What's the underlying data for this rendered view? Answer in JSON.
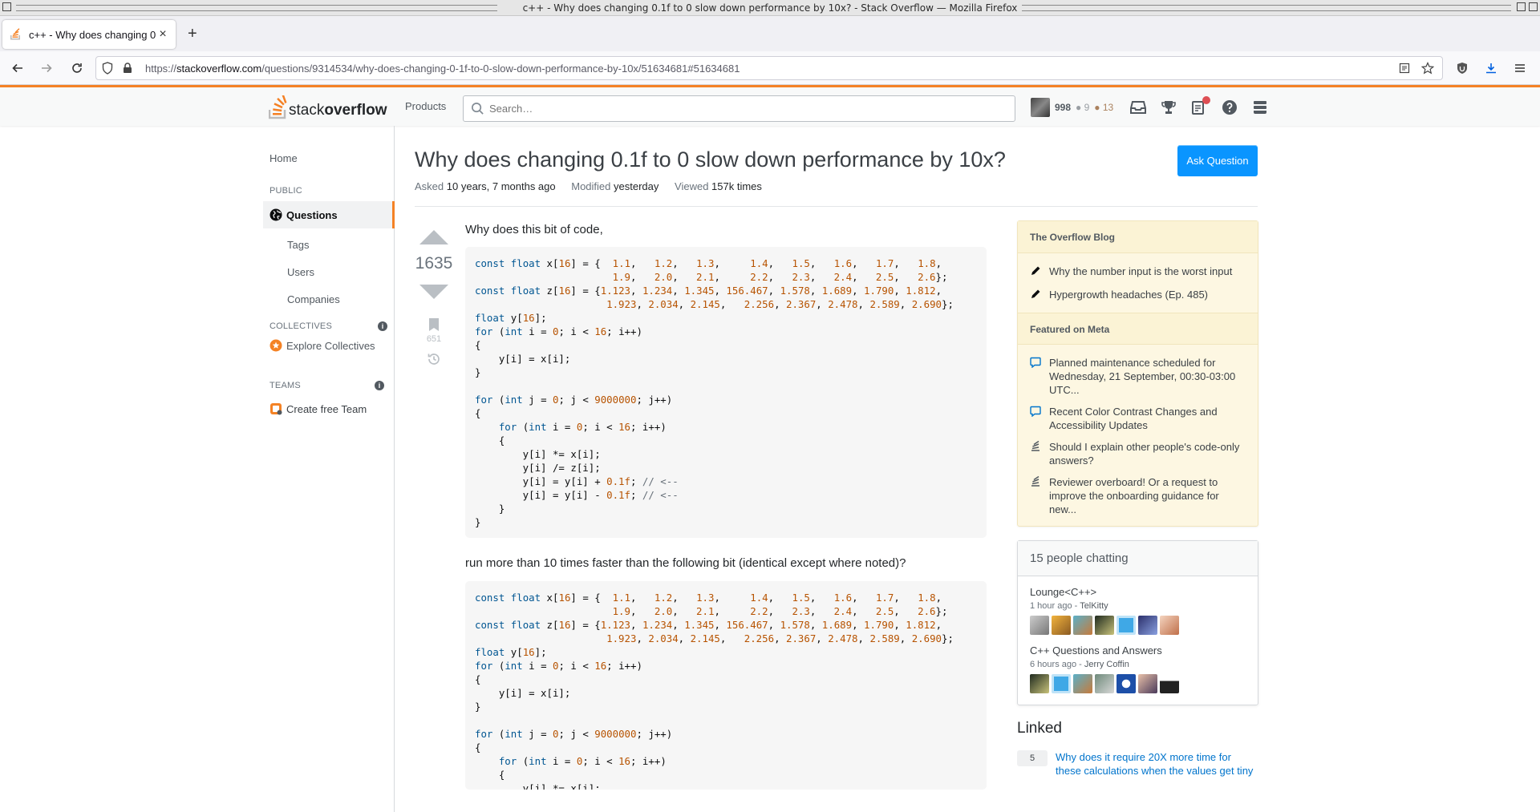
{
  "window": {
    "title": "c++ - Why does changing 0.1f to 0 slow down performance by 10x? - Stack Overflow — Mozilla Firefox"
  },
  "browser": {
    "tab_title": "c++ - Why does changing 0.1f to 0 slow dow",
    "url_prefix": "https://",
    "url_host": "stackoverflow.com",
    "url_path": "/questions/9314534/why-does-changing-0-1f-to-0-slow-down-performance-by-10x/51634681#51634681"
  },
  "so_header": {
    "logo_word1": "stack",
    "logo_word2": "overflow",
    "products": "Products",
    "search_placeholder": "Search…",
    "reputation": "998",
    "silver": "● 9",
    "bronze": "● 13"
  },
  "left_nav": {
    "home": "Home",
    "public": "PUBLIC",
    "questions": "Questions",
    "tags": "Tags",
    "users": "Users",
    "companies": "Companies",
    "collectives": "COLLECTIVES",
    "explore_collectives": "Explore Collectives",
    "teams": "TEAMS",
    "create_team": "Create free Team"
  },
  "question": {
    "title": "Why does changing 0.1f to 0 slow down performance by 10x?",
    "ask_button": "Ask Question",
    "asked_label": "Asked",
    "asked_value": "10 years, 7 months ago",
    "modified_label": "Modified",
    "modified_value": "yesterday",
    "viewed_label": "Viewed",
    "viewed_value": "157k times",
    "votes": "1635",
    "bookmarks": "651",
    "intro": "Why does this bit of code,",
    "between": "run more than 10 times faster than the following bit (identical except where noted)?"
  },
  "sidebar": {
    "blog_header": "The Overflow Blog",
    "blog_items": [
      "Why the number input is the worst input",
      "Hypergrowth headaches (Ep. 485)"
    ],
    "meta_header": "Featured on Meta",
    "meta_items": [
      "Planned maintenance scheduled for Wednesday, 21 September, 00:30-03:00 UTC...",
      "Recent Color Contrast Changes and Accessibility Updates",
      "Should I explain other people's code-only answers?",
      "Reviewer overboard! Or a request to improve the onboarding guidance for new..."
    ],
    "chat_header": "15 people chatting",
    "rooms": [
      {
        "name": "Lounge<C++>",
        "time": "1 hour ago - ",
        "user": "TelKitty"
      },
      {
        "name": "C++ Questions and Answers",
        "time": "6 hours ago - ",
        "user": "Jerry Coffin"
      }
    ],
    "linked_header": "Linked",
    "linked_items": [
      {
        "votes": "5",
        "title": "Why does it require 20X more time for these calculations when the values get tiny"
      }
    ]
  },
  "colors": {
    "accent": "#f48225",
    "button": "#0a95ff",
    "link": "#0074cc"
  }
}
